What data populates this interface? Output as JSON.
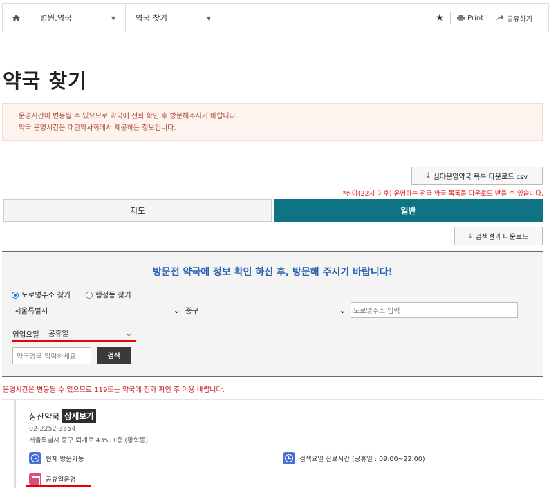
{
  "breadcrumb": {
    "home_icon": "home-icon",
    "level1": "병원.약국",
    "level2": "약국 찾기"
  },
  "toolbar": {
    "favorite_icon": "star-icon",
    "print_label": "Print",
    "share_label": "공유하기"
  },
  "page": {
    "title": "약국 찾기"
  },
  "notice": {
    "line1": "운영시간이 변동될 수 있으므로 약국에 전화 확인 후 방문해주시기 바랍니다.",
    "line2": "약국 운영시간은 대한약사회에서 제공하는 정보입니다."
  },
  "night_download": {
    "label": "심야운영약국 목록 다운로드 csv",
    "note": "*심야(22시 이후) 운영하는 전국 약국 목록을 다운로드 받을 수 있습니다."
  },
  "tabs": [
    {
      "label": "지도",
      "active": false
    },
    {
      "label": "일반",
      "active": true
    }
  ],
  "result_download": {
    "label": "검색결과 다운로드"
  },
  "search": {
    "heading": "방문전 약국에 정보 확인 하신 후, 방문해 주시기 바랍니다!",
    "radio_road": "도로명주소 찾기",
    "radio_dong": "행정동 찾기",
    "selected_radio": "road",
    "city_value": "서울특별시",
    "district_value": "중구",
    "road_placeholder": "도로명주소 입력",
    "day_label": "영업요일",
    "day_value": "공휴일",
    "name_placeholder": "약국명을 입력하세요",
    "submit_label": "검색"
  },
  "warning": "운영시간은 변동될 수 있으므로 119또는 약국에 전화 확인 후 이용 바랍니다.",
  "results": [
    {
      "name": "상산약국",
      "detail_label": "상세보기",
      "phone": "02-2252-3354",
      "address": "서울특별시 중구 퇴계로 435, 1층 (황학동)",
      "status_now": "현재 방문가능",
      "hours": "검색요일 진료시간 (공휴일 : 09:00~22:00)",
      "holiday": "공휴일운영"
    }
  ],
  "colors": {
    "tab_active": "#0e7484",
    "heading_blue": "#2a63b0",
    "warning_red": "#c81818",
    "notice_bg": "#fdf3ef",
    "clock_icon": "#4a6fd1",
    "calendar_icon": "#d84f78"
  }
}
